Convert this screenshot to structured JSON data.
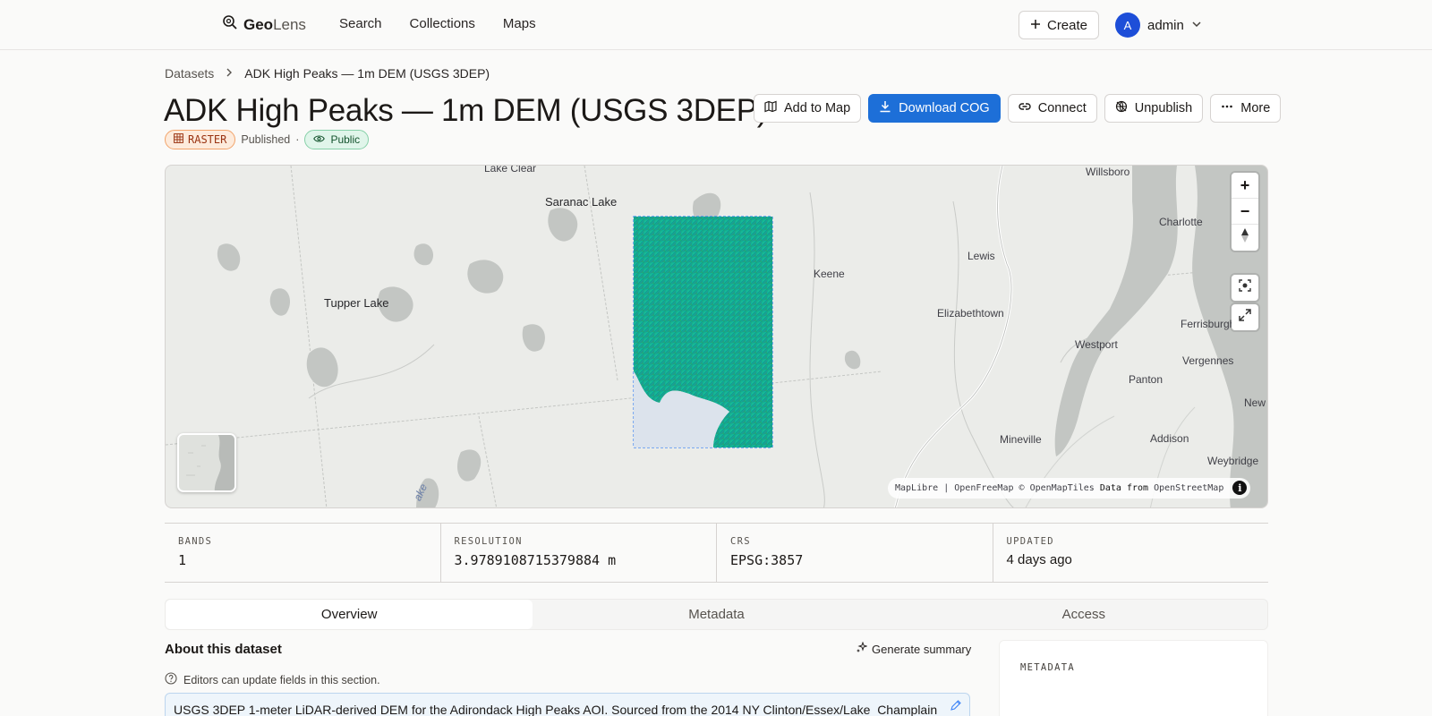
{
  "nav": {
    "logo_bold": "Geo",
    "logo_light": "Lens",
    "links": [
      "Search",
      "Collections",
      "Maps"
    ],
    "create_label": "Create",
    "user_initial": "A",
    "user_name": "admin"
  },
  "breadcrumb": {
    "root": "Datasets",
    "current": "ADK High Peaks — 1m DEM (USGS 3DEP)"
  },
  "dataset": {
    "title": "ADK High Peaks — 1m DEM (USGS 3DEP)",
    "type_badge": "RASTER",
    "status": "Published",
    "separator": "·",
    "visibility": "Public"
  },
  "actions": {
    "add_to_map": "Add to Map",
    "download": "Download COG",
    "connect": "Connect",
    "unpublish": "Unpublish",
    "more": "More"
  },
  "map": {
    "labels": {
      "lake_clear": "Lake Clear",
      "saranac_lake": "Saranac Lake",
      "tupper_lake": "Tupper Lake",
      "keene": "Keene",
      "lewis": "Lewis",
      "elizabethtown": "Elizabethtown",
      "westport": "Westport",
      "willsboro": "Willsboro",
      "charlotte": "Charlotte",
      "ferrisburgh": "Ferrisburgh",
      "vergennes": "Vergennes",
      "panton": "Panton",
      "new": "New",
      "addison": "Addison",
      "weybridge": "Weybridge",
      "mineville": "Mineville",
      "lake_text": "ake"
    },
    "attribution": {
      "maplibre": "MapLibre",
      "sep": "|",
      "openfreemap": "OpenFreeMap",
      "copy": "© OpenMapTiles",
      "data_from": "Data from",
      "osm": "OpenStreetMap"
    },
    "controls": {
      "zoom_in": "+",
      "zoom_out": "−",
      "info": "i"
    }
  },
  "stats": [
    {
      "label": "BANDS",
      "value": "1"
    },
    {
      "label": "RESOLUTION",
      "value": "3.9789108715379884 m"
    },
    {
      "label": "CRS",
      "value": "EPSG:3857"
    },
    {
      "label": "UPDATED",
      "value": "4 days ago"
    }
  ],
  "tabs": [
    "Overview",
    "Metadata",
    "Access"
  ],
  "about": {
    "heading": "About this dataset",
    "generate_summary": "Generate summary",
    "editors_note": "Editors can update fields in this section.",
    "description": "USGS 3DEP 1-meter LiDAR-derived DEM for the Adirondack High Peaks AOI. Sourced from the 2014 NY Clinton/Essex/Lake_Champlain"
  },
  "side_panel": {
    "label": "METADATA"
  }
}
